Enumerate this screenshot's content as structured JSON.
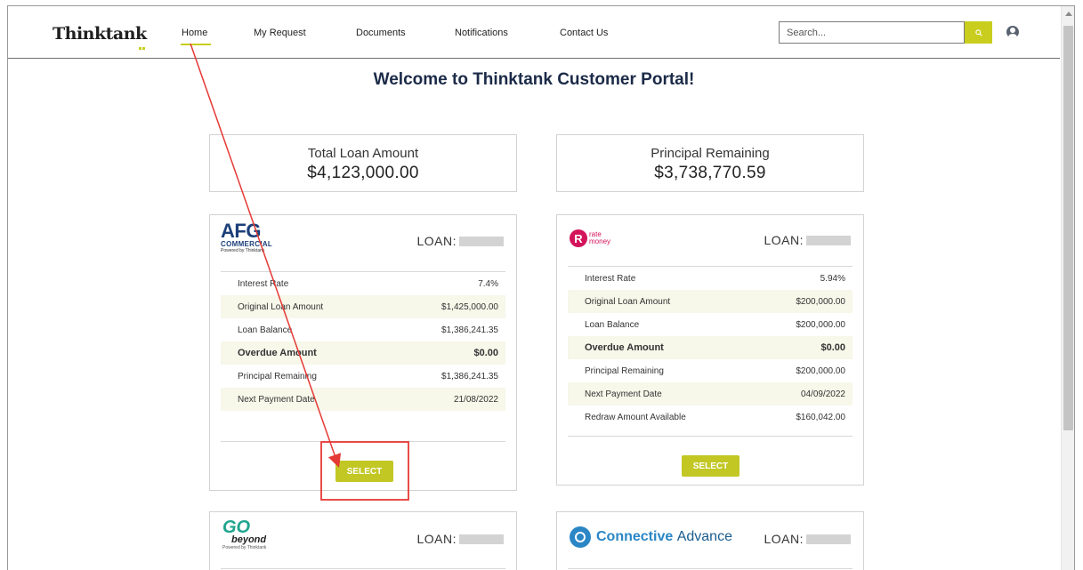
{
  "header": {
    "logo": "Thinktank",
    "nav": [
      {
        "label": "Home"
      },
      {
        "label": "My Request"
      },
      {
        "label": "Documents"
      },
      {
        "label": "Notifications"
      },
      {
        "label": "Contact Us"
      }
    ],
    "search_placeholder": "Search..."
  },
  "welcome": "Welcome to Thinktank Customer Portal!",
  "summary": {
    "total_label": "Total Loan Amount",
    "total_value": "$4,123,000.00",
    "principal_label": "Principal Remaining",
    "principal_value": "$3,738,770.59"
  },
  "loan_label": "LOAN:",
  "select_label": "SELECT",
  "logos": {
    "afg_main": "AFG",
    "afg_sub": "COMMERCIAL",
    "afg_tiny": "Powered by Thinktank",
    "rate_r": "R",
    "rate_line1": "rate",
    "rate_line2": "money",
    "go_main": "GO",
    "go_sub": "beyond",
    "go_tiny": "Powered by Thinktank",
    "connective_1": "Connective",
    "connective_2": "Advance"
  },
  "loans": [
    {
      "rows": [
        {
          "label": "Interest Rate",
          "value": "7.4%"
        },
        {
          "label": "Original Loan Amount",
          "value": "$1,425,000.00"
        },
        {
          "label": "Loan Balance",
          "value": "$1,386,241.35"
        },
        {
          "label": "Overdue Amount",
          "value": "$0.00"
        },
        {
          "label": "Principal Remaining",
          "value": "$1,386,241.35"
        },
        {
          "label": "Next Payment Date",
          "value": "21/08/2022"
        }
      ]
    },
    {
      "rows": [
        {
          "label": "Interest Rate",
          "value": "5.94%"
        },
        {
          "label": "Original Loan Amount",
          "value": "$200,000.00"
        },
        {
          "label": "Loan Balance",
          "value": "$200,000.00"
        },
        {
          "label": "Overdue Amount",
          "value": "$0.00"
        },
        {
          "label": "Principal Remaining",
          "value": "$200,000.00"
        },
        {
          "label": "Next Payment Date",
          "value": "04/09/2022"
        },
        {
          "label": "Redraw Amount Available",
          "value": "$160,042.00"
        }
      ]
    }
  ],
  "colors": {
    "accent": "#c9ce1e",
    "annotation": "#e53935",
    "heading": "#1b2a47"
  }
}
